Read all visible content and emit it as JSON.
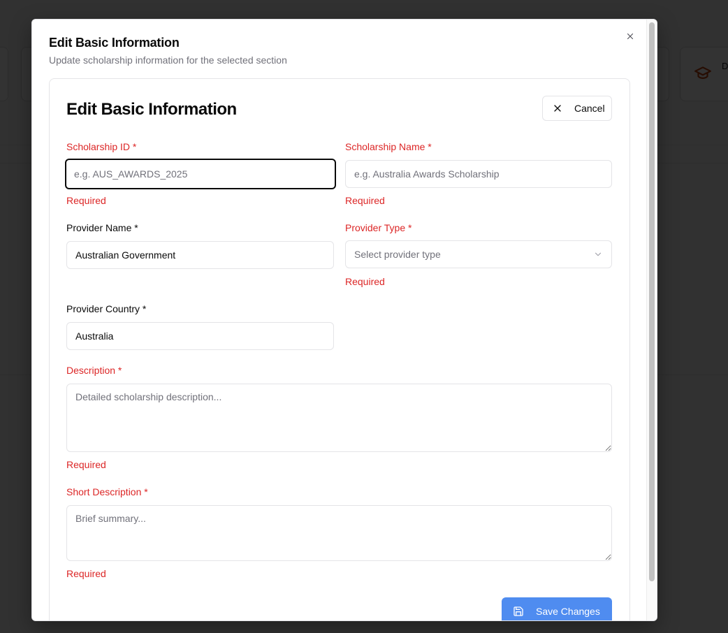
{
  "dialog": {
    "title": "Edit Basic Information",
    "description": "Update scholarship information for the selected section"
  },
  "form": {
    "title": "Edit Basic Information",
    "cancel_label": "Cancel",
    "save_label": "Save Changes",
    "fields": {
      "scholarship_id": {
        "label": "Scholarship ID *",
        "placeholder": "e.g. AUS_AWARDS_2025",
        "value": "",
        "error": "Required"
      },
      "scholarship_name": {
        "label": "Scholarship Name *",
        "placeholder": "e.g. Australia Awards Scholarship",
        "value": "",
        "error": "Required"
      },
      "provider_name": {
        "label": "Provider Name *",
        "value": "Australian Government"
      },
      "provider_type": {
        "label": "Provider Type *",
        "placeholder": "Select provider type",
        "error": "Required"
      },
      "provider_country": {
        "label": "Provider Country *",
        "value": "Australia"
      },
      "description": {
        "label": "Description *",
        "placeholder": "Detailed scholarship description...",
        "error": "Required"
      },
      "short_description": {
        "label": "Short Description *",
        "placeholder": "Brief summary...",
        "error": "Required"
      }
    }
  },
  "background": {
    "partial_text": "D"
  },
  "colors": {
    "error": "#dc2626",
    "primary_button": "#4f8cf0",
    "overlay": "rgba(0,0,0,0.8)"
  }
}
